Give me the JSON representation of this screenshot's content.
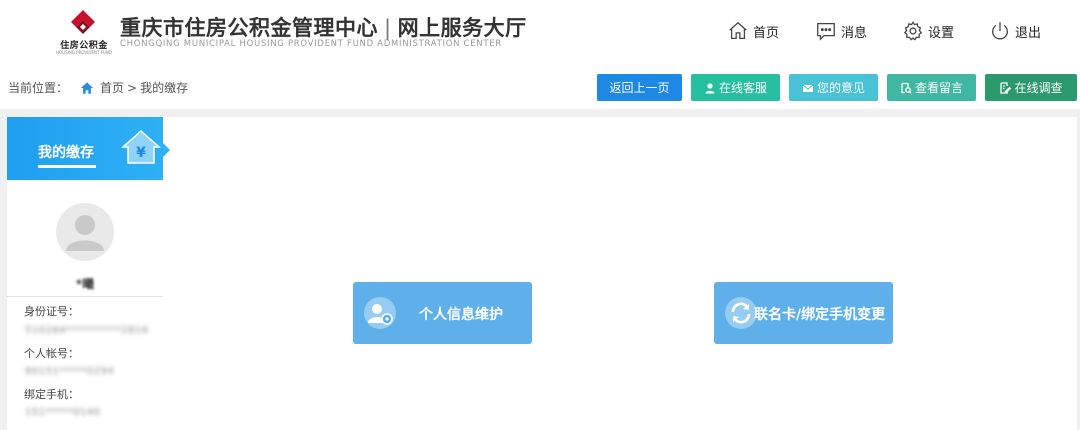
{
  "header": {
    "logo_text": "住房公积金",
    "logo_sub": "HOUSING PROVIDENT FUND",
    "title_cn": "重庆市住房公积金管理中心",
    "separator": "|",
    "title_portal": "网上服务大厅",
    "title_en": "CHONGQING MUNICIPAL HOUSING PROVIDENT FUND ADMINISTRATION CENTER",
    "nav": {
      "home": "首页",
      "messages": "消息",
      "settings": "设置",
      "logout": "退出"
    }
  },
  "breadcrumb": {
    "label": "当前位置：",
    "home": "首页",
    "separator": ">",
    "current": "我的缴存"
  },
  "toolbar": {
    "back": "返回上一页",
    "customer_service": "在线客服",
    "feedback": "您的意见",
    "view_messages": "查看留言",
    "survey": "在线调查"
  },
  "sidebar": {
    "title": "我的缴存",
    "house_symbol": "¥",
    "username": "*曦",
    "id_label": "身份证号：",
    "id_value": "510264**********2816",
    "account_label": "个人帐号：",
    "account_value": "80151*****0294",
    "phone_label": "绑定手机：",
    "phone_value": "151*****0140"
  },
  "tiles": {
    "personal": "个人信息维护",
    "card_phone": "联名卡/绑定手机变更"
  },
  "colors": {
    "back": "#1e88e5",
    "customer_service": "#26bfa0",
    "feedback": "#4ac2d6",
    "view_messages": "#40b7a2",
    "survey": "#2a9a6e",
    "tile": "#5fafeb",
    "logo_red": "#c8102e"
  }
}
